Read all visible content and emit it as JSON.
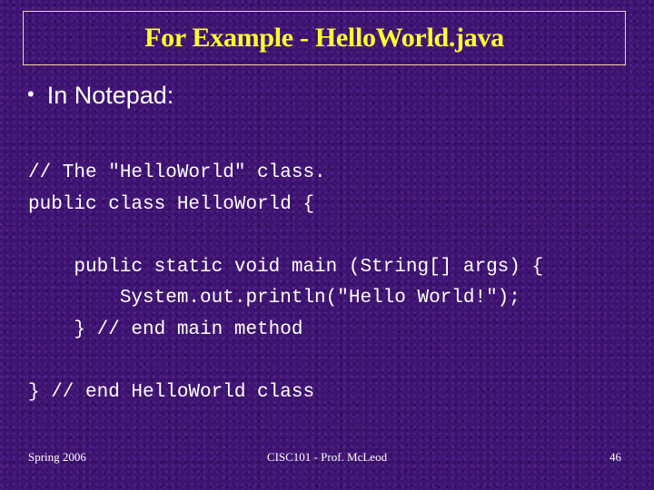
{
  "slide": {
    "title": "For Example - HelloWorld.java",
    "bullet": {
      "marker": "•",
      "text": "In Notepad:"
    },
    "code_lines": [
      "// The \"HelloWorld\" class.",
      "public class HelloWorld {",
      "",
      "    public static void main (String[] args) {",
      "        System.out.println(\"Hello World!\");",
      "    } // end main method",
      "",
      "} // end HelloWorld class"
    ],
    "footer": {
      "left": "Spring 2006",
      "center": "CISC101 - Prof. McLeod",
      "page_number": "46"
    },
    "colors": {
      "background": "#3e1472",
      "title_text": "#ffff2a",
      "title_border": "#f5d79a",
      "body_text": "#ffffff"
    }
  }
}
